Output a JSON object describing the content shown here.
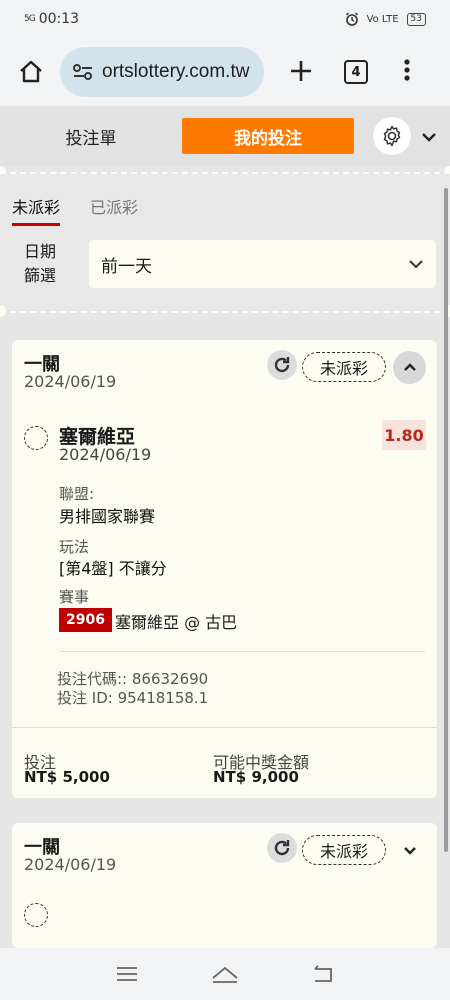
{
  "status_bar": {
    "signal": "5G",
    "time": "00:13",
    "network": "Vo LTE",
    "battery": "53"
  },
  "browser": {
    "url": "ortslottery.com.tw",
    "tab_count": "4"
  },
  "header": {
    "bet_slip_label": "投注單",
    "my_bets_label": "我的投注"
  },
  "filters": {
    "tab_unsettled": "未派彩",
    "tab_settled": "已派彩",
    "date_label": "日期篩選",
    "date_value": "前一天"
  },
  "bets": [
    {
      "title": "一關",
      "date": "2024/06/19",
      "status": "未派彩",
      "selection": {
        "name": "塞爾維亞",
        "date": "2024/06/19",
        "odds": "1.80",
        "league_label": "聯盟:",
        "league": "男排國家聯賽",
        "market_label": "玩法",
        "market": "[第4盤] 不讓分",
        "event_label": "賽事",
        "event_code": "2906",
        "event_name": "塞爾維亞 @ 古巴"
      },
      "bet_code_line": "投注代碼:: 86632690",
      "bet_id_line": "投注 ID: 95418158.1",
      "stake_label": "投注",
      "stake_value": "NT$ 5,000",
      "payout_label": "可能中獎金額",
      "payout_value": "NT$ 9,000"
    },
    {
      "title": "一關",
      "date": "2024/06/19",
      "status": "未派彩"
    }
  ],
  "colors": {
    "accent": "#ff7a00",
    "card_bg": "#fdfcf3",
    "event_code_bg": "#c00000",
    "odds_text": "#b52a1b",
    "tab_underline": "#d10000"
  },
  "icons": [
    "home-icon",
    "tune-icon",
    "plus-icon",
    "tabs-icon",
    "more-vert-icon",
    "gear-icon",
    "chevron-down-icon",
    "refresh-icon",
    "chevron-up-icon",
    "menu-icon",
    "home-outline-icon",
    "back-icon"
  ]
}
